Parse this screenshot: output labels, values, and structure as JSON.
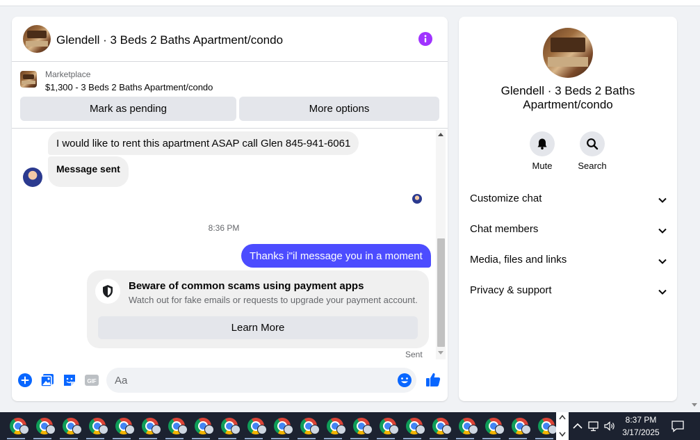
{
  "chat": {
    "title": "Glendell · 3 Beds 2 Baths Apartment/condo",
    "listing_source": "Marketplace",
    "listing_desc": "$1,300 - 3 Beds 2 Baths Apartment/condo",
    "mark_pending_label": "Mark as pending",
    "more_options_label": "More options",
    "messages": {
      "incoming_1": "I would like to rent this apartment ASAP call Glen 845-941-6061",
      "incoming_2": "Message sent",
      "timestamp": "8:36 PM",
      "outgoing_1": "Thanks i\"il message you in a moment",
      "scam_title": "Beware of common scams using payment apps",
      "scam_text": "Watch out for fake emails or requests to upgrade your payment account.",
      "learn_more_label": "Learn More",
      "status": "Sent"
    },
    "composer": {
      "placeholder": "Aa"
    },
    "icons": {
      "info": "info-icon",
      "add": "plus-circle-icon",
      "photo": "photo-icon",
      "sticker": "sticker-icon",
      "gif": "gif-icon",
      "emoji": "emoji-icon",
      "like": "thumbs-up-icon",
      "shield": "shield-icon"
    }
  },
  "info_panel": {
    "title": "Glendell · 3 Beds 2 Baths Apartment/condo",
    "actions": [
      {
        "label": "Mute",
        "icon": "bell-icon"
      },
      {
        "label": "Search",
        "icon": "search-icon"
      }
    ],
    "sections": [
      {
        "label": "Customize chat"
      },
      {
        "label": "Chat members"
      },
      {
        "label": "Media, files and links"
      },
      {
        "label": "Privacy & support"
      }
    ]
  },
  "taskbar": {
    "time": "8:37 PM",
    "date": "3/17/2025",
    "app_count": 21
  },
  "colors": {
    "accent": "#4c4cff",
    "info_purple": "#a033ff",
    "composer_blue": "#0866ff",
    "taskbar": "#1c2230"
  }
}
